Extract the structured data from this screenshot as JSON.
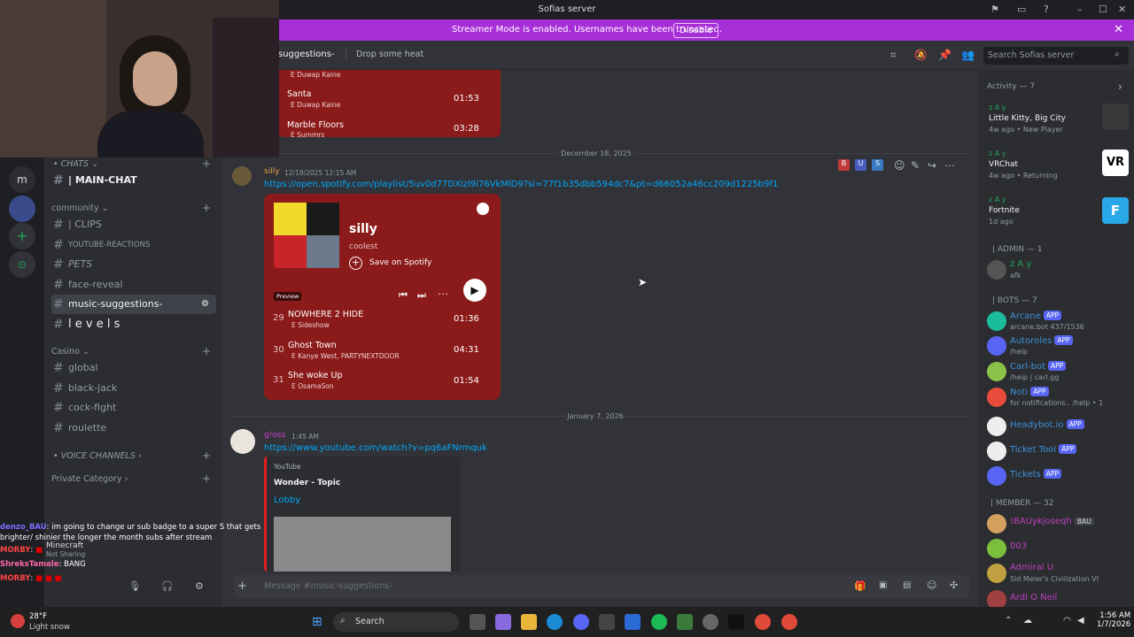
{
  "titlebar": {
    "title": "Sofias server"
  },
  "banner": {
    "text": "Streamer Mode is enabled. Usernames have been truncated.",
    "button": "Disable"
  },
  "sidebar": {
    "user_initial": "m",
    "categories": {
      "chats": "CHATS",
      "community": "community",
      "casino": "Casino",
      "voice": "VOICE CHANNELS",
      "private": "Private Category"
    },
    "channels": {
      "main": "| MAIN-CHAT",
      "clips": "| CLIPS",
      "youtube": "YOUTUBE-REACTIONS",
      "pets": "PETS",
      "face": "face-reveal",
      "music": "music-suggestions-",
      "levels": "l e v e l s",
      "global": "global",
      "blackjack": "black-jack",
      "cockfight": "cock-fight",
      "roulette": "roulette"
    },
    "activity": {
      "game": "Minecraft",
      "status": "Not Sharing"
    }
  },
  "header": {
    "channel": "suggestions-",
    "topic": "Drop some heat",
    "search_placeholder": "Search Sofias server"
  },
  "chat": {
    "top_tracks": [
      {
        "name": "Santa",
        "artist": "Duwap Kaine",
        "dur": "01:53"
      },
      {
        "name": "Marble Floors",
        "artist": "Summrs",
        "dur": "03:28"
      }
    ],
    "top_artist": "Duwap Kaine",
    "date1": "December 18, 2025",
    "msg1": {
      "user": "silly",
      "time": "12/18/2025 12:15 AM",
      "link": "https://open.spotify.com/playlist/5uv0d77DXlzl9i76VkMlD9?si=77f1b35dbb594dc7&pt=d66052a46cc209d1225b9f155ac21dba"
    },
    "spotify": {
      "title": "silly",
      "subtitle": "coolest",
      "save": "Save on Spotify",
      "preview": "Preview",
      "tracks": [
        {
          "num": "29",
          "name": "NOWHERE 2 HIDE",
          "artist": "Sideshow",
          "dur": "01:36"
        },
        {
          "num": "30",
          "name": "Ghost Town",
          "artist": "Kanye West, PARTYNEXTDOOR",
          "dur": "04:31"
        },
        {
          "num": "31",
          "name": "She woke Up",
          "artist": "OsamaSon",
          "dur": "01:54"
        }
      ]
    },
    "date2": "January 7, 2026",
    "msg2": {
      "user": "g!oss",
      "time": "1:45 AM",
      "link": "https://www.youtube.com/watch?v=pq6aFNrmquk",
      "embed_site": "YouTube",
      "embed_author": "Wonder - Topic",
      "embed_title": "Lobby"
    },
    "composer_placeholder": "Message #music-suggestions-",
    "explicit": "E"
  },
  "members": {
    "activity_header": "Activity — 7",
    "activities": [
      {
        "name": "z A y",
        "game": "Little Kitty, Big City",
        "meta": "4w ago",
        "tag": "New Player"
      },
      {
        "name": "z A y",
        "game": "VRChat",
        "meta": "4w ago",
        "tag": "Returning"
      },
      {
        "name": "z A y",
        "game": "Fortnite",
        "meta": "1d ago",
        "tag": ""
      }
    ],
    "admin_header": "| ADMIN — 1",
    "admin": {
      "name": "z A y",
      "sub": "afk"
    },
    "bots_header": "| BOTS — 7",
    "bots": [
      {
        "name": "Arcane",
        "sub": "arcane.bot 437/1536",
        "color": "#1abc9c"
      },
      {
        "name": "Autoroles",
        "sub": "/help",
        "color": "#5865f2"
      },
      {
        "name": "Carl-bot",
        "sub": "/help | carl.gg",
        "color": "#8bc34a"
      },
      {
        "name": "Noti",
        "sub": "for notifications.. /help • 1",
        "color": "#e74c3c"
      },
      {
        "name": "Headybot.io",
        "sub": "",
        "color": "#eeeeee"
      },
      {
        "name": "Ticket Tool",
        "sub": "",
        "color": "#eeeeee"
      },
      {
        "name": "Tickets",
        "sub": "",
        "color": "#5865f2"
      }
    ],
    "bot_badge": "APP",
    "member_header": "| MEMBER — 32",
    "member_list": [
      {
        "name": "!BAUykjoseqh",
        "sub": "",
        "badge": "BAU"
      },
      {
        "name": "003",
        "sub": ""
      },
      {
        "name": "Admiral U",
        "sub": "Sid Meier's Civilization VI"
      },
      {
        "name": "Ardi O Neil",
        "sub": ""
      }
    ]
  },
  "stream_chat": [
    {
      "user": "denzo_BAU",
      "text": ": im going to change ur sub badge to a super S that gets brighter/ shinier the longer the month subs after stream",
      "color": "#7a6cff"
    },
    {
      "user": "MORBY",
      "text": ":",
      "color": "#ff4444"
    },
    {
      "user": "ShreksTamale",
      "text": ": BANG",
      "color": "#ff66aa"
    },
    {
      "user": "MORBY",
      "text": ":",
      "color": "#ff4444"
    }
  ],
  "taskbar": {
    "weather_temp": "28°F",
    "weather_desc": "Light snow",
    "search": "Search",
    "time": "1:56 AM",
    "date": "1/7/2026"
  }
}
